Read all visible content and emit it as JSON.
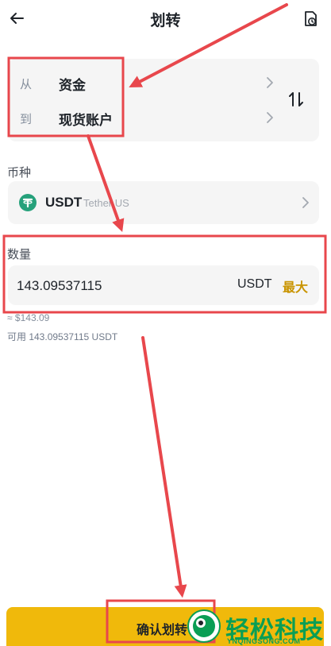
{
  "header": {
    "title": "划转",
    "back_icon": "back-arrow-icon",
    "history_icon": "history-document-icon"
  },
  "transfer": {
    "from_label": "从",
    "from_value": "资金",
    "to_label": "到",
    "to_value": "现货账户",
    "swap_icon": "swap-vertical-icon"
  },
  "coin": {
    "label": "币种",
    "symbol": "USDT",
    "full_name": "Tether US",
    "icon": "tether-icon"
  },
  "amount": {
    "label": "数量",
    "value": "143.09537115",
    "unit": "USDT",
    "max_label": "最大",
    "approx": "≈ $143.09",
    "available": "可用 143.09537115 USDT"
  },
  "confirm_label": "确认划转",
  "watermark": {
    "text": "轻松科技",
    "sub": "YNQINGSONG.COM"
  },
  "colors": {
    "accent": "#f0b90b",
    "max_text": "#c99400",
    "card_bg": "#f5f5f5",
    "annotation": "#e8474c",
    "tether": "#26a17b",
    "watermark": "#0a9e54"
  }
}
